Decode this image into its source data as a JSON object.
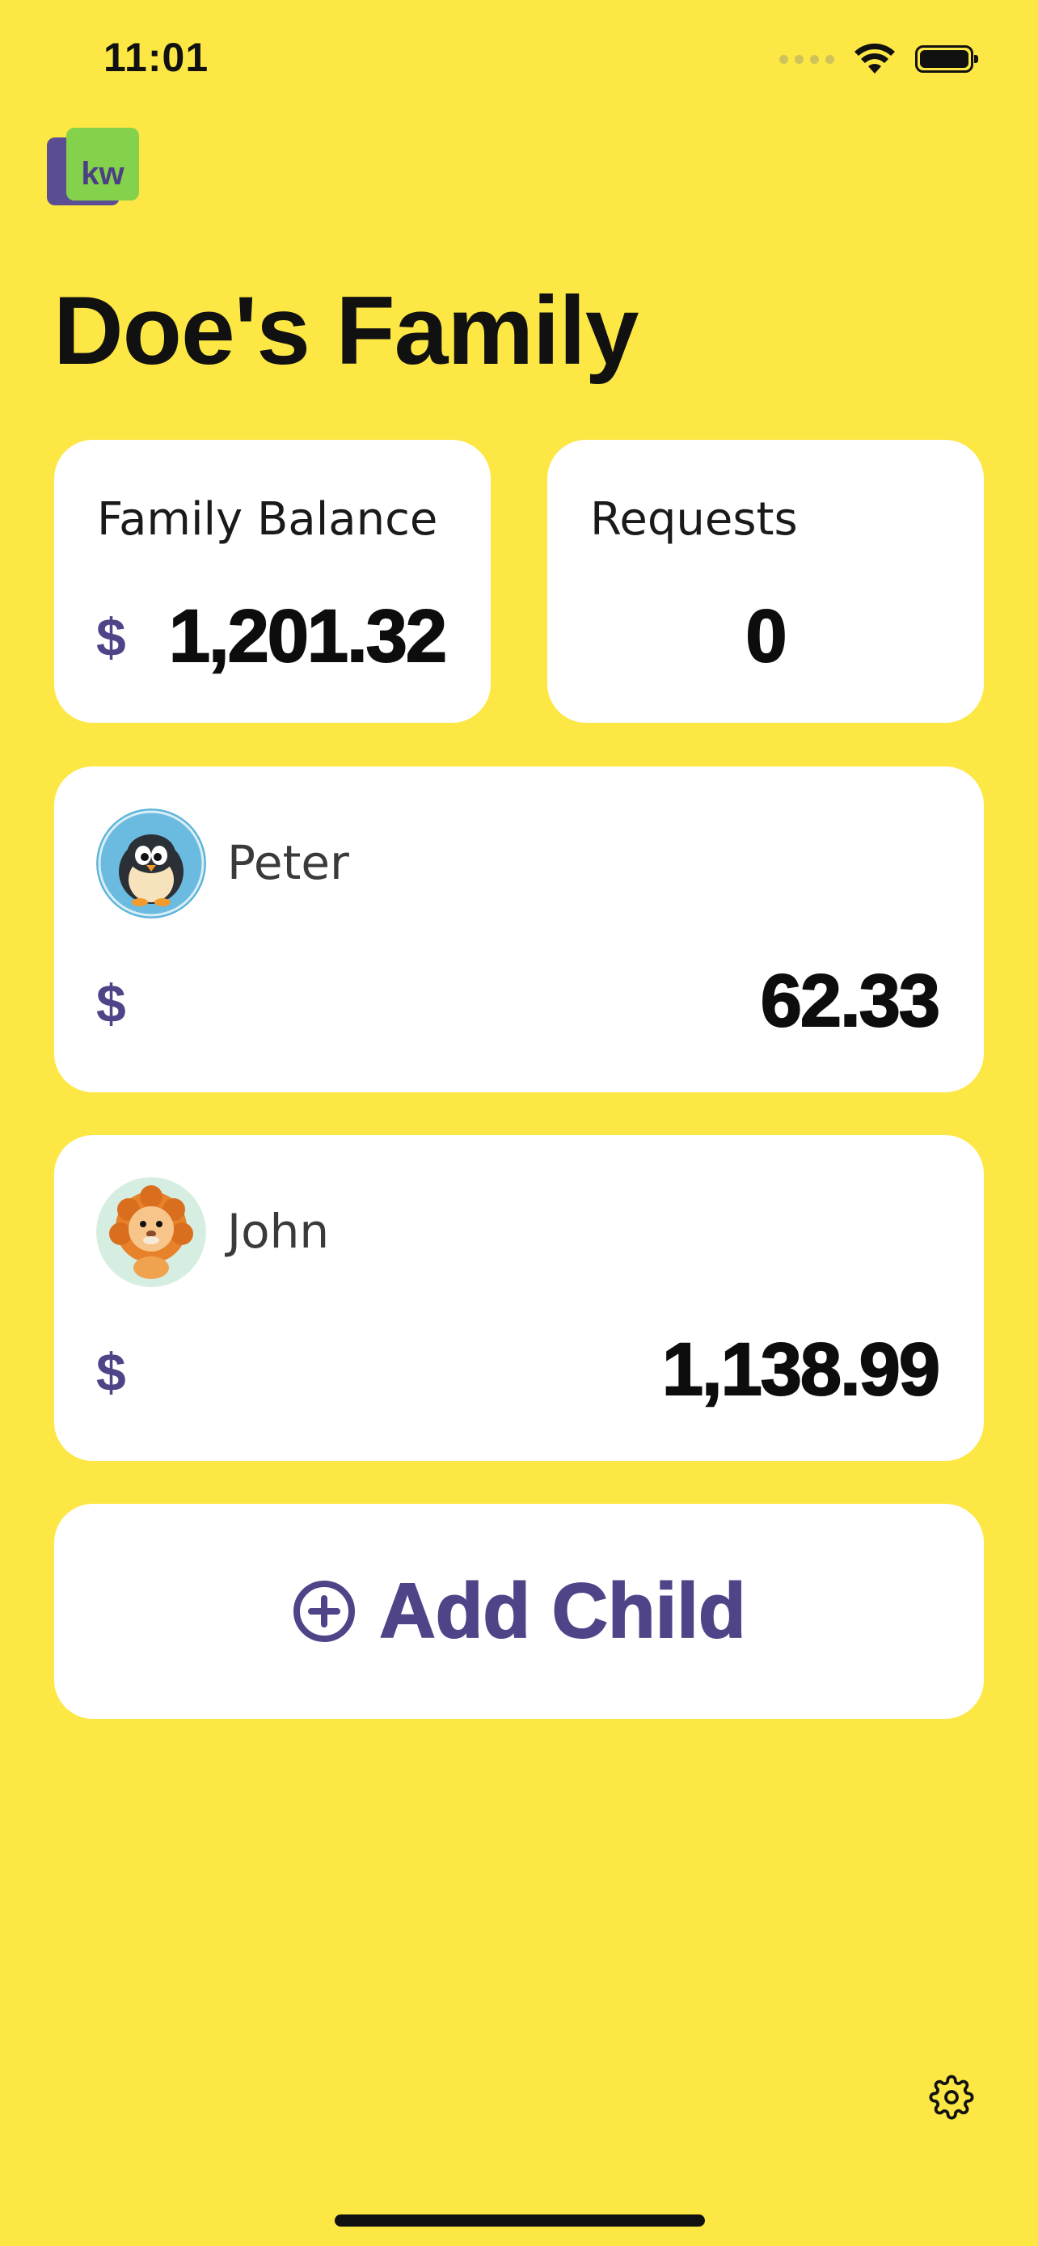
{
  "status_bar": {
    "time": "11:01"
  },
  "logo": {
    "text": "kw",
    "colors": {
      "front": "#84D14B",
      "back": "#5B4D93"
    }
  },
  "header": {
    "title": "Doe's Family"
  },
  "summary": {
    "balance": {
      "label": "Family Balance",
      "currency": "$",
      "amount": "1,201.32"
    },
    "requests": {
      "label": "Requests",
      "count": "0"
    }
  },
  "children": [
    {
      "name": "Peter",
      "avatar": "penguin-avatar",
      "currency": "$",
      "balance": "62.33"
    },
    {
      "name": "John",
      "avatar": "lion-avatar",
      "currency": "$",
      "balance": "1,138.99"
    }
  ],
  "actions": {
    "add_child_label": "Add Child",
    "add_icon": "plus-circle-icon",
    "settings_icon": "gear-icon"
  },
  "theme": {
    "background": "#FCE744",
    "accent": "#4F4487",
    "card": "#FFFFFF"
  }
}
